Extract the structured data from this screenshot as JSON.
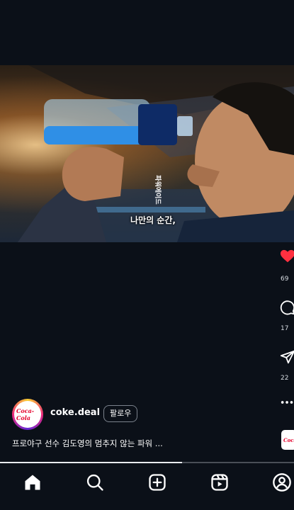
{
  "video": {
    "subtitle": "나만의 순간,",
    "bottle_label": "파워에이드"
  },
  "side_actions": {
    "like": {
      "icon": "heart-filled-icon",
      "count": "69",
      "color": "#ff3040"
    },
    "comment": {
      "icon": "comment-icon",
      "count": "17"
    },
    "share": {
      "icon": "send-icon",
      "count": "22"
    },
    "more": {
      "icon": "more-horizontal-icon"
    }
  },
  "post": {
    "avatar_text": "Coca-Cola",
    "username": "coke.deal",
    "follow_label": "팔로우",
    "caption": "프로야구 선수 김도영의 멈추지 않는 파워 ...",
    "audio_thumb_text": "Coca"
  },
  "progress": {
    "fraction": 0.62
  },
  "navbar": {
    "items": [
      {
        "icon": "home-icon",
        "active": true
      },
      {
        "icon": "search-icon"
      },
      {
        "icon": "create-post-icon"
      },
      {
        "icon": "reels-icon"
      },
      {
        "icon": "profile-icon"
      }
    ]
  }
}
